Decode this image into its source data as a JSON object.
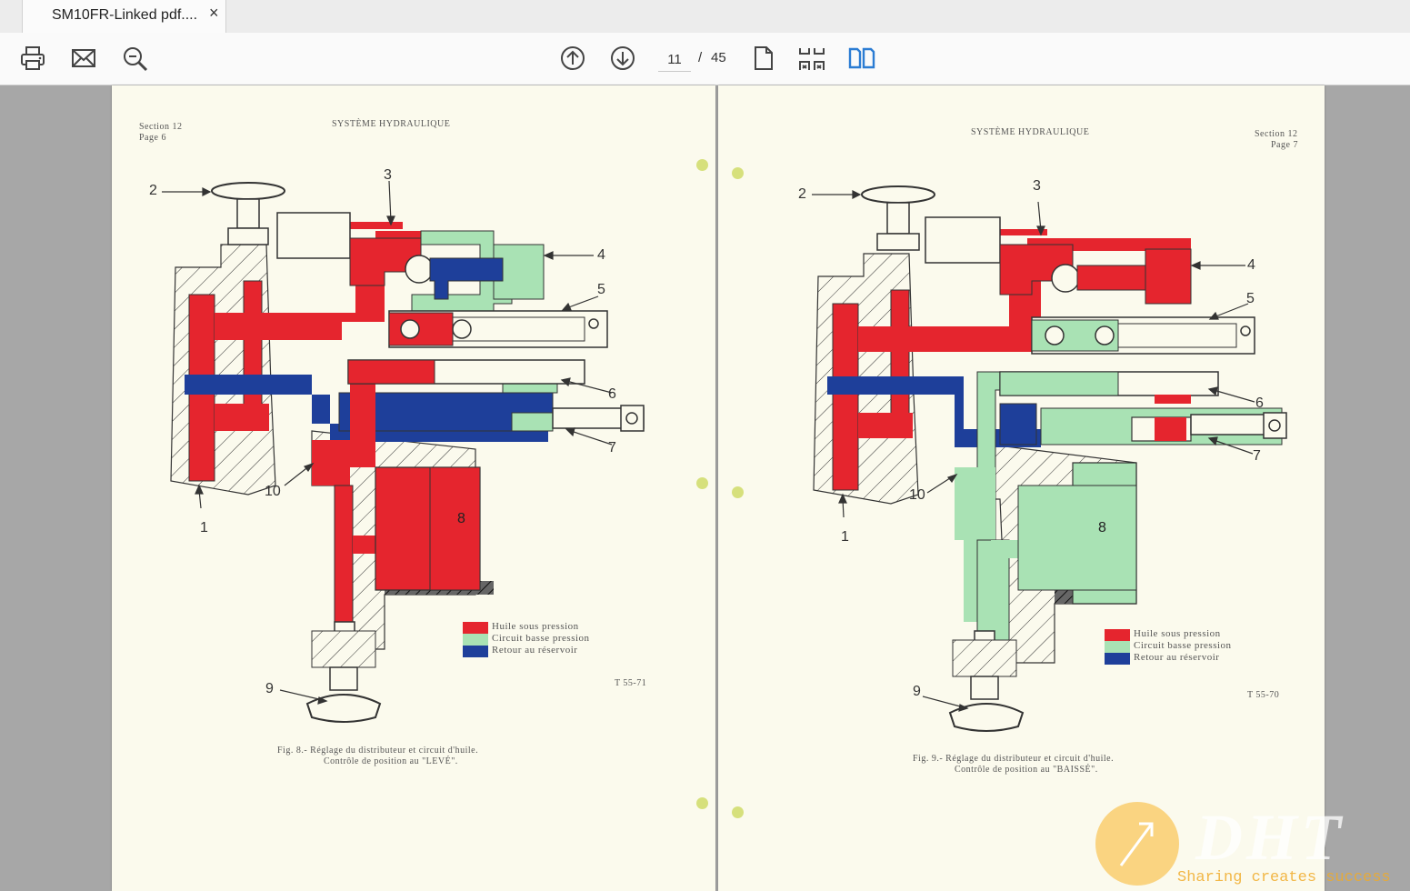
{
  "tab": {
    "title": "SM10FR-Linked pdf....",
    "close": "×"
  },
  "toolbar": {
    "print_icon": "print-icon",
    "email_icon": "envelope-icon",
    "search_icon": "zoom-search-icon",
    "prev_icon": "arrow-up-circle-icon",
    "next_icon": "arrow-down-circle-icon",
    "current_page": "11",
    "separator": "/",
    "total_pages": "45",
    "single_page_icon": "single-page-icon",
    "scroll_mode_icon": "continuous-scroll-icon",
    "two_page_icon": "two-page-view-icon",
    "accent": "#2b7cd3"
  },
  "colors": {
    "high_pressure": "#e5252e",
    "low_pressure": "#a9e2b4",
    "return": "#1e3f9a",
    "paper": "#fbfaed"
  },
  "left_page": {
    "section": "Section 12",
    "page": "Page 6",
    "title": "SYSTÈME HYDRAULIQUE",
    "callouts": [
      "1",
      "2",
      "3",
      "4",
      "5",
      "6",
      "7",
      "8",
      "9",
      "10"
    ],
    "legend": [
      "Huile sous pression",
      "Circuit basse pression",
      "Retour au réservoir"
    ],
    "ref": "T 55-71",
    "caption_line1": "Fig. 8.- Réglage du distributeur et circuit d'huile.",
    "caption_line2": "Contrôle de position au \"LEVÉ\"."
  },
  "right_page": {
    "section": "Section 12",
    "page": "Page 7",
    "title": "SYSTÈME HYDRAULIQUE",
    "callouts": [
      "1",
      "2",
      "3",
      "4",
      "5",
      "6",
      "7",
      "8",
      "9",
      "10"
    ],
    "legend": [
      "Huile sous pression",
      "Circuit basse pression",
      "Retour au réservoir"
    ],
    "ref": "T 55-70",
    "caption_line1": "Fig. 9.- Réglage du distributeur et circuit d'huile.",
    "caption_line2": "Contrôle de position au \"BAISSÉ\"."
  },
  "watermark": {
    "logo": "DHT",
    "slogan": "Sharing creates success"
  }
}
